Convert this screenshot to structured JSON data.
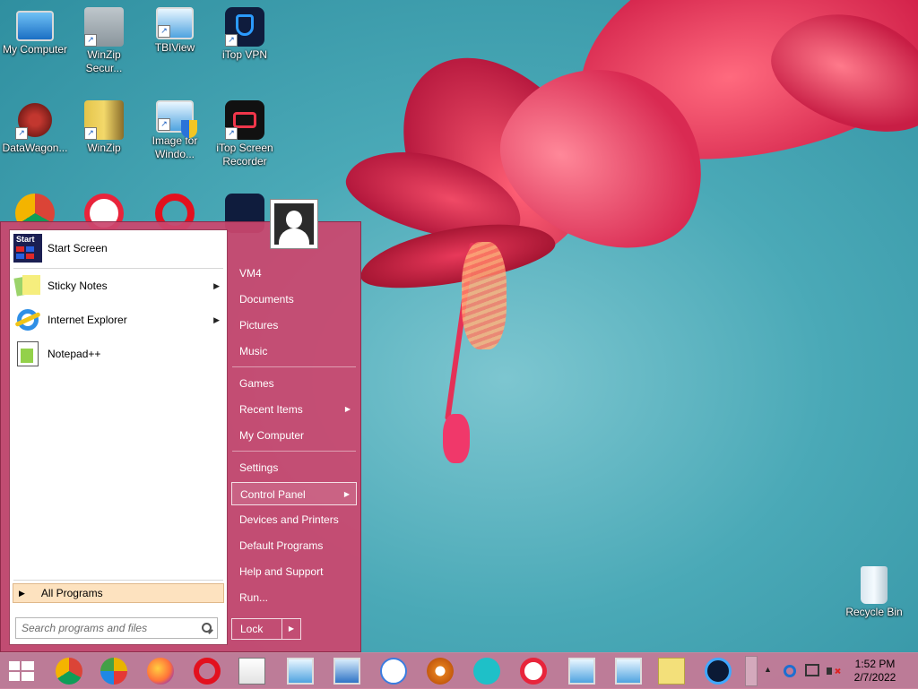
{
  "desktop": {
    "icons": [
      {
        "label": "My Computer"
      },
      {
        "label": "WinZip Secur..."
      },
      {
        "label": "TBIView"
      },
      {
        "label": "iTop VPN"
      },
      {
        "label": "DataWagon..."
      },
      {
        "label": "WinZip"
      },
      {
        "label": "Image for Windo..."
      },
      {
        "label": "iTop Screen Recorder"
      },
      {
        "label": "Recycle Bin"
      }
    ]
  },
  "start_menu": {
    "pinned": [
      {
        "label": "Start Screen",
        "icon": "start-screen-icon",
        "badge": "Start"
      },
      {
        "label": "Sticky Notes",
        "icon": "sticky-notes-icon",
        "has_submenu": true
      },
      {
        "label": "Internet Explorer",
        "icon": "internet-explorer-icon",
        "has_submenu": true
      },
      {
        "label": "Notepad++",
        "icon": "notepad-plus-plus-icon"
      }
    ],
    "all_programs": "All Programs",
    "search_placeholder": "Search programs and files",
    "right_items": [
      {
        "label": "VM4"
      },
      {
        "label": "Documents"
      },
      {
        "label": "Pictures"
      },
      {
        "label": "Music"
      },
      {
        "label": "Games"
      },
      {
        "label": "Recent Items"
      },
      {
        "label": "My Computer"
      },
      {
        "label": "Settings"
      },
      {
        "label": "Control Panel"
      },
      {
        "label": "Devices and Printers"
      },
      {
        "label": "Default Programs"
      },
      {
        "label": "Help and Support"
      },
      {
        "label": "Run..."
      }
    ],
    "lock_label": "Lock",
    "arrow_glyph": "▶"
  },
  "taskbar": {
    "apps": [
      "chrome-icon",
      "privacy-app-icon",
      "firefox-icon",
      "opera-icon",
      "pdf-icon",
      "tbiview-icon",
      "image-viewer-icon",
      "arrow-app-icon",
      "settings-app-icon",
      "remote-app-icon",
      "recorder-app-icon",
      "monitor-icon",
      "monitor-icon",
      "sticky-notes-icon",
      "ccleaner-icon"
    ],
    "tray_arrow": "▲",
    "clock": {
      "time": "1:52 PM",
      "date": "2/7/2022"
    }
  },
  "colors": {
    "start_menu": "#cb466e",
    "taskbar": "#c87896",
    "all_programs_highlight": "#fde2bf"
  }
}
